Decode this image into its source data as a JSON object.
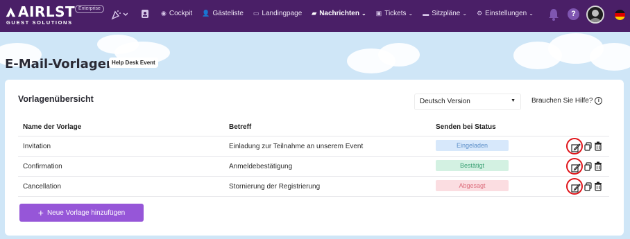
{
  "brand": {
    "name": "AIRLST",
    "tagline": "GUEST SOLUTIONS",
    "plan_badge": "Enterprise"
  },
  "nav": {
    "items": [
      {
        "label": "Cockpit",
        "icon": "gauge-icon",
        "active": false,
        "dropdown": false
      },
      {
        "label": "Gästeliste",
        "icon": "guests-icon",
        "active": false,
        "dropdown": false
      },
      {
        "label": "Landingpage",
        "icon": "page-icon",
        "active": false,
        "dropdown": false
      },
      {
        "label": "Nachrichten",
        "icon": "car-icon",
        "active": true,
        "dropdown": true
      },
      {
        "label": "Tickets",
        "icon": "ticket-icon",
        "active": false,
        "dropdown": true
      },
      {
        "label": "Sitzpläne",
        "icon": "seats-icon",
        "active": false,
        "dropdown": true
      },
      {
        "label": "Einstellungen",
        "icon": "gear-icon",
        "active": false,
        "dropdown": true
      }
    ],
    "help_label": "?"
  },
  "page": {
    "title": "E-Mail-Vorlagen",
    "event_badge": "Help Desk Event"
  },
  "card": {
    "title": "Vorlagenübersicht",
    "language_select": "Deutsch Version",
    "help_link": "Brauchen Sie Hilfe?",
    "columns": [
      "Name der Vorlage",
      "Betreff",
      "Senden bei Status"
    ],
    "rows": [
      {
        "name": "Invitation",
        "subject": "Einladung zur Teilnahme an unserem Event",
        "status": "Eingeladen",
        "status_color": "#5b8ec8"
      },
      {
        "name": "Confirmation",
        "subject": "Anmeldebestätigung",
        "status": "Bestätigt",
        "status_color": "#3ea276"
      },
      {
        "name": "Cancellation",
        "subject": "Stornierung der Registrierung",
        "status": "Abgesagt",
        "status_color": "#dd6d7c"
      }
    ],
    "add_button": "Neue Vorlage hinzufügen"
  },
  "colors": {
    "navbar": "#4a1f67",
    "accent": "#9656d8",
    "highlight_ring": "#e0141a"
  }
}
